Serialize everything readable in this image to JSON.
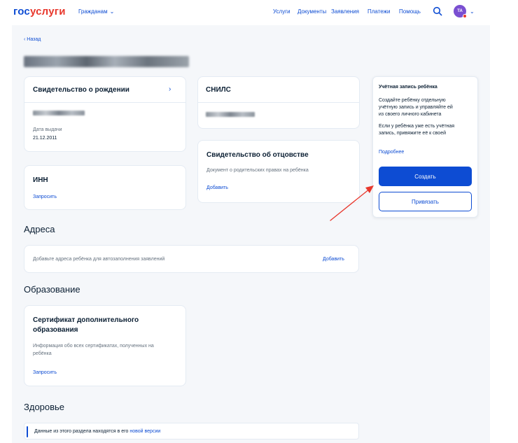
{
  "header": {
    "logo_part1": "гос",
    "logo_part2": "услуги",
    "citizens_label": "Гражданам",
    "nav": [
      "Услуги",
      "Документы",
      "Заявления",
      "Платежи",
      "Помощь"
    ],
    "avatar_initials": "ТА"
  },
  "back_label": "Назад",
  "documents": {
    "birth_cert": {
      "title": "Свидетельство о рождении",
      "date_label": "Дата выдачи",
      "date_value": "21.12.2011"
    },
    "snils": {
      "title": "СНИЛС"
    },
    "inn": {
      "title": "ИНН",
      "action": "Запросить"
    },
    "paternity": {
      "title": "Свидетельство об отцовстве",
      "description": "Документ о родительских правах на ребёнка",
      "action": "Добавить"
    }
  },
  "account_panel": {
    "title": "Учётная запись ребёнка",
    "text1_line1": "Создайте ребёнку отдельную",
    "text1_line2": "учётную запись и управляйте ей",
    "text1_line3": "из своего личного кабинета",
    "text2_line1": "Если у ребёнка уже есть учётная",
    "text2_line2": "запись, привяжите её к своей",
    "more_link": "Подробнее",
    "create_button": "Создать",
    "link_button": "Привязать"
  },
  "addresses": {
    "heading": "Адреса",
    "description": "Добавьте адреса ребёнка для автозаполнения заявлений",
    "action": "Добавить"
  },
  "education": {
    "heading": "Образование",
    "card_title_line1": "Сертификат дополнительного",
    "card_title_line2": "образования",
    "description_line1": "Информация обо всех сертификатах, полученных на",
    "description_line2": "ребёнка",
    "action": "Запросить"
  },
  "health": {
    "heading": "Здоровье",
    "note_text": "Данные из этого раздела находятся в его",
    "note_link": "новой версии"
  },
  "colors": {
    "accent": "#0d4cd3",
    "logo_red": "#e8372c",
    "avatar": "#7a4fd1",
    "page_bg": "#f5f7fa",
    "annotation_arrow": "#e8372c"
  }
}
